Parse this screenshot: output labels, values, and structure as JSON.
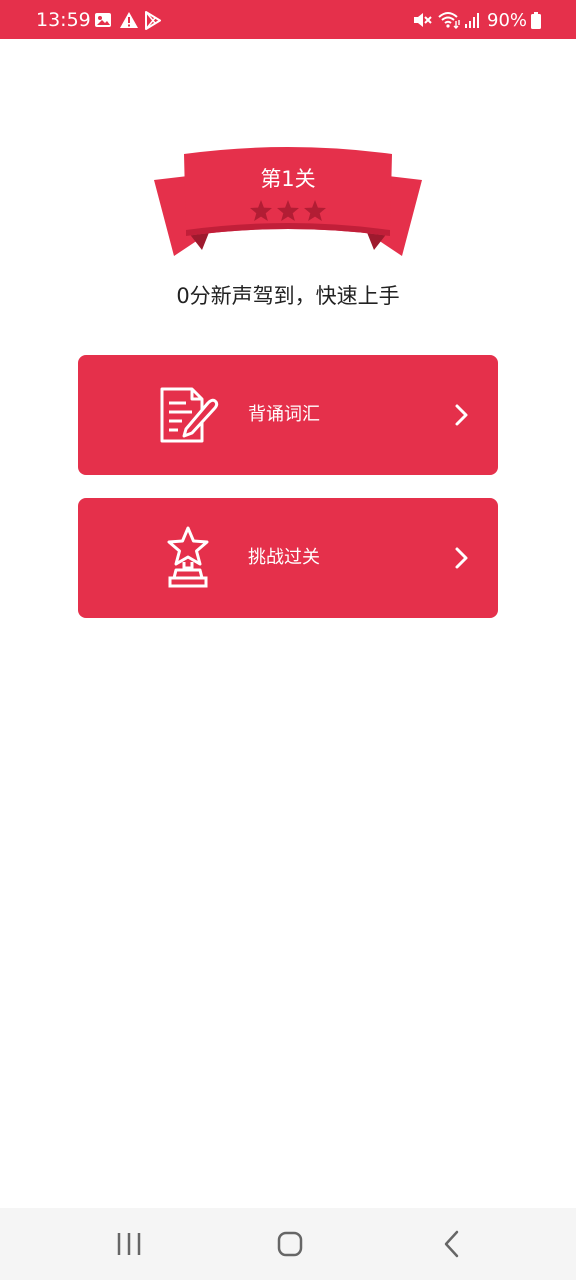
{
  "status_bar": {
    "time": "13:59",
    "battery": "90%",
    "color": "#e5304b",
    "icons": [
      "gallery-icon",
      "warning-icon",
      "play-store-icon",
      "mute-icon",
      "wifi-icon",
      "signal-icon",
      "battery-icon"
    ]
  },
  "level": {
    "title": "第1关",
    "stars_earned": 0,
    "stars_total": 3,
    "subtitle": "0分新声驾到，快速上手"
  },
  "actions": [
    {
      "label": "背诵词汇",
      "icon": "document-pen-icon"
    },
    {
      "label": "挑战过关",
      "icon": "trophy-star-icon"
    }
  ],
  "nav": {
    "buttons": [
      "recent-apps-icon",
      "home-icon",
      "back-icon"
    ]
  },
  "colors": {
    "accent": "#e5304b",
    "ribbon_dark": "#c11f39",
    "star_empty": "#b21d34",
    "nav_background": "#f5f5f5"
  }
}
